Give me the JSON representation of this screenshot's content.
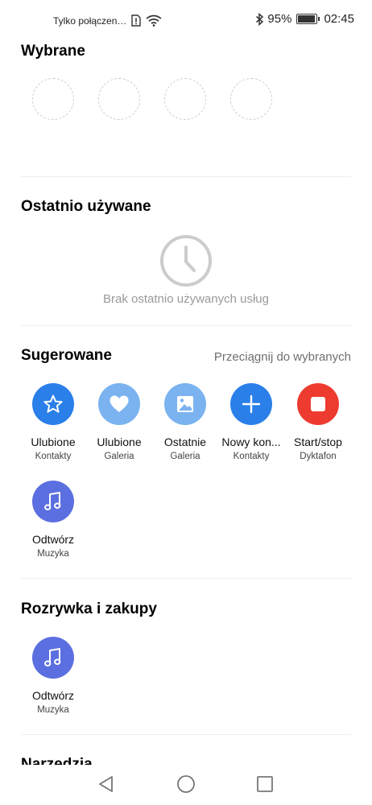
{
  "status_bar": {
    "carrier": "Tylko połączen…",
    "battery": "95%",
    "battery_level": 0.95,
    "time": "02:45",
    "icons": [
      "sim-icon",
      "wifi-icon",
      "bluetooth-icon",
      "battery-icon"
    ]
  },
  "favorites": {
    "title": "Wybrane",
    "placeholder_count": 4
  },
  "recent": {
    "title": "Ostatnio używane",
    "empty_text": "Brak ostatnio używanych usług",
    "icon": "clock-icon"
  },
  "suggested": {
    "title": "Sugerowane",
    "hint": "Przeciągnij do wybranych",
    "items": [
      {
        "label": "Ulubione",
        "sub": "Kontakty",
        "icon": "star-icon",
        "color": "#2a7fe8"
      },
      {
        "label": "Ulubione",
        "sub": "Galeria",
        "icon": "heart-icon",
        "color": "#7ab3f0"
      },
      {
        "label": "Ostatnie",
        "sub": "Galeria",
        "icon": "image-icon",
        "color": "#7ab3f0"
      },
      {
        "label": "Nowy kon...",
        "sub": "Kontakty",
        "icon": "plus-icon",
        "color": "#2a7fe8"
      },
      {
        "label": "Start/stop",
        "sub": "Dyktafon",
        "icon": "stop-icon",
        "color": "#ee3b2f"
      },
      {
        "label": "Odtwórz",
        "sub": "Muzyka",
        "icon": "music-note-icon",
        "color": "#5b6fe0"
      }
    ]
  },
  "entertainment": {
    "title": "Rozrywka i zakupy",
    "items": [
      {
        "label": "Odtwórz",
        "sub": "Muzyka",
        "icon": "music-note-icon",
        "color": "#5b6fe0"
      }
    ]
  },
  "tools": {
    "title": "Narzędzia"
  },
  "nav": {
    "icons": [
      "back-icon",
      "home-icon",
      "recents-icon"
    ]
  }
}
